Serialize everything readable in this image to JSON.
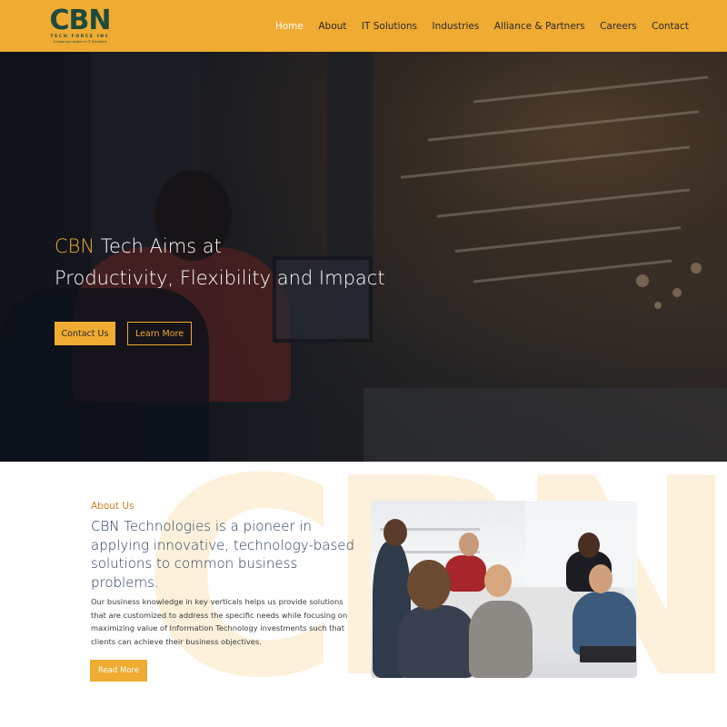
{
  "header": {
    "logo": {
      "mark": "CBN",
      "subtitle": "TECH FORCE INC",
      "tagline": "A visionary leader in IT Solutions"
    },
    "nav": [
      {
        "label": "Home",
        "active": true
      },
      {
        "label": "About",
        "active": false
      },
      {
        "label": "IT Solutions",
        "active": false
      },
      {
        "label": "Industries",
        "active": false
      },
      {
        "label": "Alliance & Partners",
        "active": false
      },
      {
        "label": "Careers",
        "active": false
      },
      {
        "label": "Contact",
        "active": false
      }
    ]
  },
  "hero": {
    "title_accent": "CBN",
    "title_line1_rest": " Tech Aims at",
    "title_line2": "Productivity, Flexibility and Impact",
    "contact_button": "Contact Us",
    "learn_button": "Learn More"
  },
  "about": {
    "kicker": "About Us",
    "heading": "CBN Technologies is a pioneer in applying innovative, technology-based solutions to common business problems.",
    "body": "Our business knowledge in key verticals helps us provide solutions that are customized to address the specific needs while focusing on maximizing value of Information Technology investments such that clients can achieve their business objectives.",
    "read_more": "Read More"
  },
  "colors": {
    "brand_yellow": "#efab32",
    "brand_green": "#1d4a3e",
    "heading_navy": "#23395a",
    "kicker_orange": "#c8852a",
    "watermark": "#fdf1dc"
  }
}
